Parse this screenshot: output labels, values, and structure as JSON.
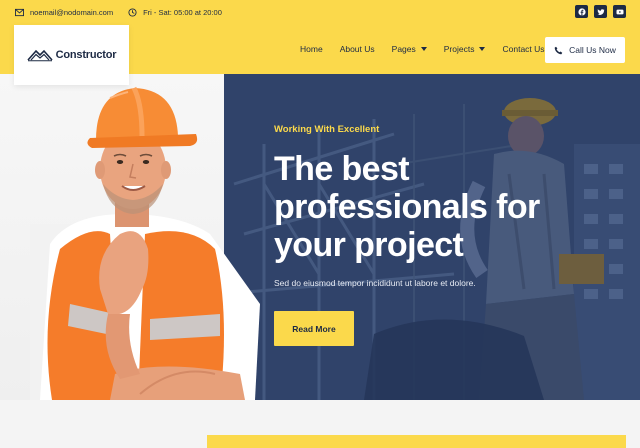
{
  "topbar": {
    "email": "noemail@nodomain.com",
    "hours": "Fri - Sat: 05:00 at 20:00",
    "socials": [
      {
        "icon": "facebook-icon"
      },
      {
        "icon": "twitter-icon"
      },
      {
        "icon": "youtube-icon"
      }
    ]
  },
  "logo": {
    "text": "Constructor"
  },
  "nav": {
    "items": [
      {
        "label": "Home"
      },
      {
        "label": "About Us"
      },
      {
        "label": "Pages"
      },
      {
        "label": "Projects"
      },
      {
        "label": "Contact Us"
      }
    ],
    "cta_label": "Call Us Now"
  },
  "hero": {
    "kicker": "Working With Excellent",
    "headline_lines": [
      "The best",
      "professionals for",
      "your project"
    ],
    "subtitle": "Sed do eiusmod tempor incididunt ut labore et dolore.",
    "button_label": "Read More"
  },
  "colors": {
    "accent": "#fbd94b",
    "navy": "#1d2a44",
    "hero_overlay": "#2b3d62"
  }
}
